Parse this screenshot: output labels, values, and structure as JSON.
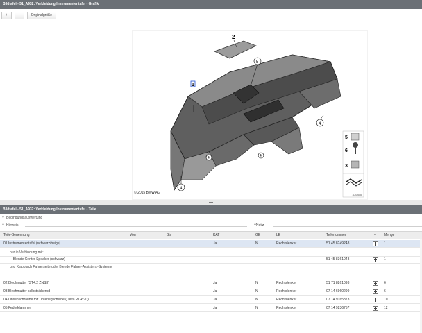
{
  "graphic_panel": {
    "title": "Bildtafel - 51_A932: Verkleidung Instrumententafel - Grafik",
    "toolbar": {
      "zoom_in": "+",
      "zoom_out": "-",
      "original_size": "Originalgröße"
    },
    "copyright": "© 2015 BMW AG",
    "image_number": "470855",
    "callouts": [
      "1",
      "2",
      "3",
      "4",
      "5",
      "6"
    ],
    "legend_numbers": [
      "5",
      "6",
      "3"
    ]
  },
  "splitter": {
    "grip": "▬"
  },
  "parts_panel": {
    "title": "Bildtafel - 51_A932: Verkleidung Instrumententafel - Teile",
    "condition_label": "Bedingungsauswertung",
    "hint_label": "Hinweis",
    "note_label": "Notiz",
    "columns": {
      "name": "Teile-Benennung",
      "from": "Von",
      "to": "Bis",
      "kat": "KAT",
      "ge": "GE",
      "le": "LE",
      "part_number": "Teilenummer",
      "plus": "+",
      "quantity": "Menge"
    },
    "rows": [
      {
        "name": "01 Instrumententafel (schwarz/beige)",
        "kat": "Ja",
        "ge": "N",
        "le": "Rechtslenker",
        "part_number": "51 45 8249248",
        "quantity": "1"
      },
      {
        "name": "nur in Verbindung mit:",
        "kat": "",
        "ge": "",
        "le": "",
        "part_number": "",
        "quantity": ""
      },
      {
        "name": "-- Blende Center Speaker (schwarz)",
        "kat": "",
        "ge": "",
        "le": "",
        "part_number": "51 45 8361043",
        "quantity": "1"
      },
      {
        "name": "und Klappfach Fahrerseite oder Blende Fahrer-Assistenz-Systeme",
        "kat": "",
        "ge": "",
        "le": "",
        "part_number": "",
        "quantity": ""
      },
      {
        "name": "02 Blechmutter (ST4,2 ZNS3)",
        "kat": "Ja",
        "ge": "N",
        "le": "Rechtslenker",
        "part_number": "51 71 8261093",
        "quantity": "6"
      },
      {
        "name": "03 Blechmutter selbstsichernd",
        "kat": "Ja",
        "ge": "N",
        "le": "Rechtslenker",
        "part_number": "07 14 6960299",
        "quantity": "6"
      },
      {
        "name": "04 Linsenschraube mit Unterlegscheibe (Delta PT4x20)",
        "kat": "Ja",
        "ge": "N",
        "le": "Rechtslenker",
        "part_number": "07 14 9165873",
        "quantity": "10"
      },
      {
        "name": "05 Federklammer",
        "kat": "Ja",
        "ge": "N",
        "le": "Rechtslenker",
        "part_number": "07 14 9236757",
        "quantity": "12"
      }
    ]
  }
}
